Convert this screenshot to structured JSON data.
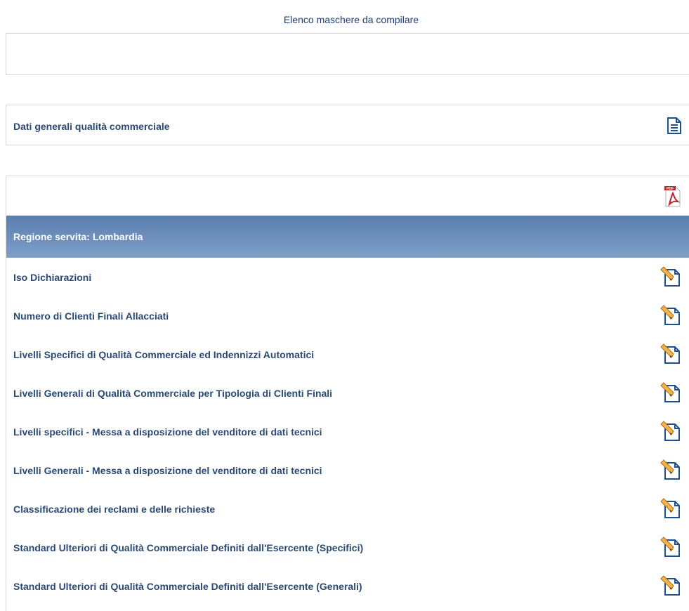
{
  "page": {
    "title": "Elenco maschere da compilare"
  },
  "general_section": {
    "label": "Dati generali qualità commerciale",
    "icon": "document-icon"
  },
  "report_section": {
    "pdf_icon": "pdf-icon",
    "region_header": "Regione servita: Lombardia",
    "items": [
      {
        "label": "Iso Dichiarazioni",
        "icon": "edit-pencil-icon"
      },
      {
        "label": "Numero di Clienti Finali Allacciati",
        "icon": "edit-pencil-icon"
      },
      {
        "label": "Livelli Specifici di Qualità Commerciale ed Indennizzi Automatici",
        "icon": "edit-pencil-icon"
      },
      {
        "label": "Livelli Generali di Qualità Commerciale per Tipologia di Clienti Finali",
        "icon": "edit-pencil-icon"
      },
      {
        "label": "Livelli specifici - Messa a disposizione del venditore di dati tecnici",
        "icon": "edit-pencil-icon"
      },
      {
        "label": "Livelli Generali - Messa a disposizione del venditore di dati tecnici",
        "icon": "edit-pencil-icon"
      },
      {
        "label": "Classificazione dei reclami e delle richieste",
        "icon": "edit-pencil-icon"
      },
      {
        "label": "Standard Ulteriori di Qualità Commerciale Definiti dall'Esercente (Specifici)",
        "icon": "edit-pencil-icon"
      },
      {
        "label": "Standard Ulteriori di Qualità Commerciale Definiti dall'Esercente (Generali)",
        "icon": "edit-pencil-icon"
      }
    ]
  },
  "colors": {
    "header_gradient_top": "#5a7eaf",
    "header_gradient_bottom": "#7f9fc7",
    "link_text": "#2b4a73",
    "border": "#d6d6d6"
  }
}
